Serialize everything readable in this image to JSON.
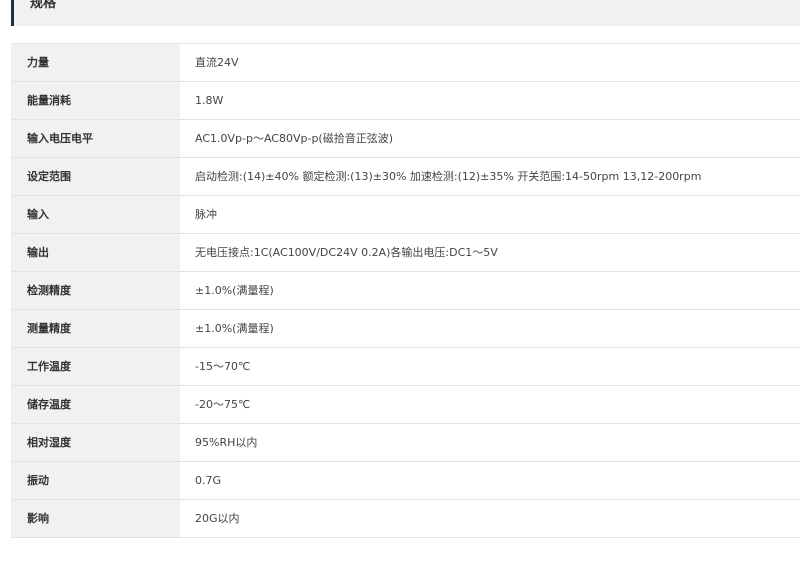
{
  "section": {
    "title": "规格"
  },
  "specs": [
    {
      "label": "力量",
      "value": "直流24V"
    },
    {
      "label": "能量消耗",
      "value": "1.8W"
    },
    {
      "label": "输入电压电平",
      "value": "AC1.0Vp-p～AC80Vp-p(磁拾音正弦波)"
    },
    {
      "label": "设定范围",
      "value": "启动检测:(14)±40% 额定检测:(13)±30% 加速检测:(12)±35% 开关范围:14-50rpm 13,12-200rpm"
    },
    {
      "label": "输入",
      "value": "脉冲"
    },
    {
      "label": "输出",
      "value": "无电压接点:1C(AC100V/DC24V 0.2A)各输出电压:DC1～5V"
    },
    {
      "label": "检测精度",
      "value": "±1.0%(满量程)"
    },
    {
      "label": "测量精度",
      "value": "±1.0%(满量程)"
    },
    {
      "label": "工作温度",
      "value": "-15～70℃"
    },
    {
      "label": "储存温度",
      "value": "-20～75℃"
    },
    {
      "label": "相对湿度",
      "value": "95%RH以内"
    },
    {
      "label": "振动",
      "value": "0.7G"
    },
    {
      "label": "影响",
      "value": "20G以内"
    }
  ]
}
